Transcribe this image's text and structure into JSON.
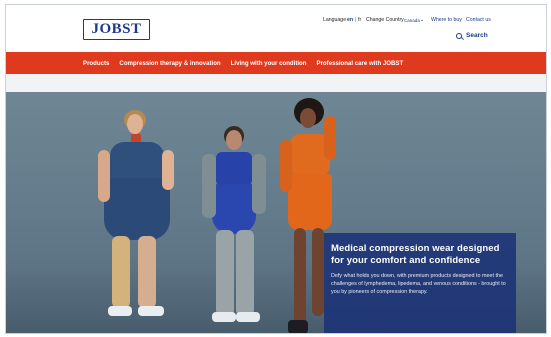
{
  "header": {
    "logo_text": "JOBST",
    "utility": {
      "language_label": "Language",
      "lang_en": "en",
      "separator": "|",
      "lang_fr": "fr",
      "change_country": "Change Country",
      "country": "Canada",
      "where_to_buy": "Where to buy",
      "contact_us": "Contact us"
    },
    "search_label": "Search"
  },
  "nav": {
    "items": [
      {
        "label": "Products"
      },
      {
        "label": "Compression therapy & innovation"
      },
      {
        "label": "Living with your condition"
      },
      {
        "label": "Professional care with JOBST"
      }
    ]
  },
  "hero": {
    "title": "Medical compression wear designed for your comfort and confidence",
    "body": "Defy what holds you down, with premium products designed to meet the challenges of lymphedema, lipedema, and venous conditions - brought to you by pioneers of compression therapy."
  },
  "colors": {
    "brand_blue": "#1b3a8a",
    "nav_red": "#e03a1e",
    "card_blue": "#1b3278"
  }
}
